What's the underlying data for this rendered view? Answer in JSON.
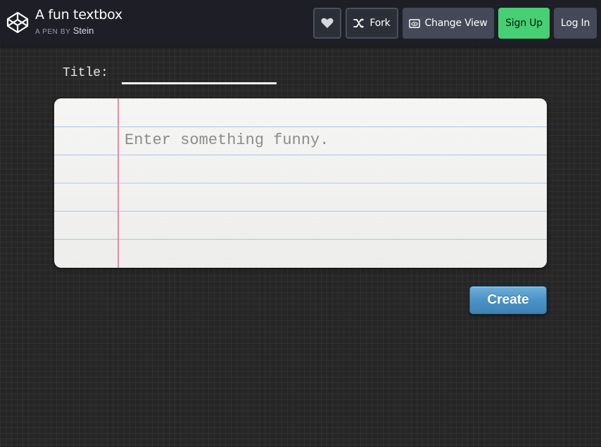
{
  "header": {
    "pen_title": "A fun textbox",
    "byline_prefix": "A PEN BY",
    "author": "Stein",
    "logo_icon": "codepen-cube-icon",
    "buttons": {
      "heart_icon": "heart-icon",
      "fork_label": "Fork",
      "change_view_label": "Change View",
      "signup_label": "Sign Up",
      "login_label": "Log In"
    }
  },
  "form": {
    "title_label": "Title:",
    "title_value": "",
    "textbox_placeholder": "Enter something funny.",
    "textbox_value": "",
    "create_label": "Create"
  },
  "colors": {
    "background": "#262626",
    "header": "#1e1f26",
    "signup_green": "#47cf73",
    "paper": "#f3f3f2",
    "ruled_line": "#a9c7ee",
    "margin_line": "#ec8aa6",
    "create_button": "#4a93c6"
  }
}
